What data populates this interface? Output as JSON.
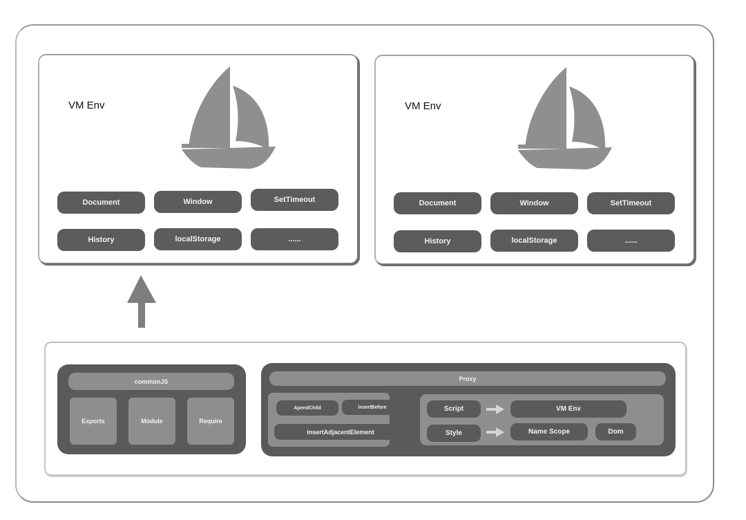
{
  "diagram": {
    "vm_cards": [
      {
        "title": "VM Env",
        "icon": "sailboat-icon",
        "apis": [
          "Document",
          "Window",
          "SetTimeout",
          "History",
          "localStorage",
          "......"
        ]
      },
      {
        "title": "VM Env",
        "icon": "sailboat-icon",
        "apis": [
          "Document",
          "Window",
          "SetTimeout",
          "History",
          "localStorage",
          "......"
        ]
      }
    ],
    "up_arrow": "arrow-up-icon",
    "commonjs": {
      "title": "commonJS",
      "items": [
        "Exports",
        "Module",
        "Require"
      ]
    },
    "proxy": {
      "title": "Proxy",
      "dom_methods": [
        "ApendChild",
        "insertBefore",
        "insertAdjacentElement"
      ],
      "rules": [
        {
          "from": "Script",
          "to": [
            "VM Env"
          ]
        },
        {
          "from": "Style",
          "to": [
            "Name Scope",
            "Dom"
          ]
        }
      ]
    },
    "colors": {
      "dark_box": "#5a5a5a",
      "mid_box": "#8e8e8e",
      "sail": "#8f8f8f",
      "arrow": "#7e7e7e"
    }
  }
}
